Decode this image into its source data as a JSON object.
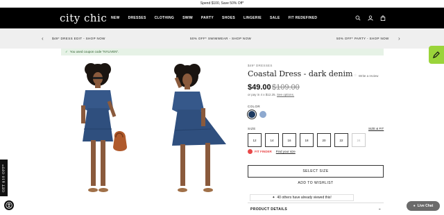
{
  "promo": {
    "text": "Spend $100, Save 50% Off*"
  },
  "brand": {
    "logo": "city chic"
  },
  "nav": {
    "items": [
      "NEW",
      "DRESSES",
      "CLOTHING",
      "SWIM",
      "PARTY",
      "SHOES",
      "LINGERIE",
      "SALE",
      "FIT REDEFINED"
    ],
    "icons": [
      "search-icon",
      "account-icon",
      "bag-icon"
    ]
  },
  "offers": {
    "left": "$49* DRESS EDIT - SHOP NOW",
    "center": "50% OFF* SWIMWEAR - SHOP NOW",
    "right": "50% OFF* PARTY - SHOP NOW",
    "prev_icon": "chevron-left-icon",
    "next_icon": "chevron-right-icon"
  },
  "coupon": {
    "text": "You used coupon code \"NYLIVEN\"."
  },
  "product": {
    "breadcrumb": "$49* DRESSES",
    "title": "Coastal Dress - dark denim",
    "review_label": "Write a review",
    "rating_stars": 0,
    "price": "$49.00",
    "old_price": "$109.00",
    "afterpay_text": "or pay in 4 x $12.25.",
    "afterpay_link": "See options.",
    "color_label": "COLOR",
    "colors": [
      "#1e3a5f",
      "#8ea9cf"
    ],
    "size_label": "SIZE",
    "size_fit": "SIZE & FIT",
    "sizes": [
      {
        "label": "12",
        "available": true
      },
      {
        "label": "14",
        "available": true
      },
      {
        "label": "16",
        "available": true
      },
      {
        "label": "18",
        "available": true
      },
      {
        "label": "20",
        "available": true
      },
      {
        "label": "22",
        "available": true
      },
      {
        "label": "24",
        "available": false
      }
    ],
    "fit_finder": "FIT FINDER",
    "find_size": "Find your size",
    "select_size": "SELECT SIZE",
    "add_wishlist": "ADD TO WISHLIST",
    "viewed_text": "40 others have already viewed this!",
    "details_label": "PRODUCT DETAILS"
  },
  "side_tab": {
    "text": "GET $10 OFF*"
  },
  "live_chat": {
    "label": "Live Chat"
  },
  "colors": {
    "nav_bg": "#000000",
    "offer_bg": "#efefef",
    "coupon_bg": "#e6f2e6",
    "green_tab": "#9ad43a",
    "fit_accent": "#e8494a"
  }
}
